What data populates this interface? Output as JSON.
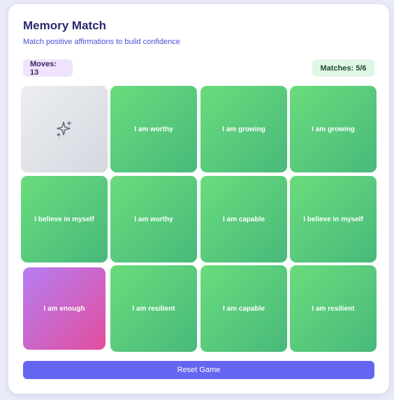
{
  "header": {
    "title": "Memory Match",
    "subtitle": "Match positive affirmations to build confidence"
  },
  "stats": {
    "moves": "Moves: 13",
    "matches": "Matches: 5/6"
  },
  "cards": [
    {
      "state": "hidden",
      "label": "",
      "icon": "sparkles-icon"
    },
    {
      "state": "matched",
      "label": "I am worthy"
    },
    {
      "state": "matched",
      "label": "I am growing"
    },
    {
      "state": "matched",
      "label": "I am growing"
    },
    {
      "state": "matched",
      "label": "I believe in myself"
    },
    {
      "state": "matched",
      "label": "I am worthy"
    },
    {
      "state": "matched",
      "label": "I am capable"
    },
    {
      "state": "matched",
      "label": "I believe in myself"
    },
    {
      "state": "revealed",
      "label": "I am enough"
    },
    {
      "state": "matched",
      "label": "I am resilient"
    },
    {
      "state": "matched",
      "label": "I am capable"
    },
    {
      "state": "matched",
      "label": "I am resilient"
    }
  ],
  "actions": {
    "reset_label": "Reset Game"
  },
  "colors": {
    "accent": "#6466f1",
    "matched": "#5acb7c",
    "revealed": "#c96ad0",
    "hidden": "#e1e3e8"
  }
}
